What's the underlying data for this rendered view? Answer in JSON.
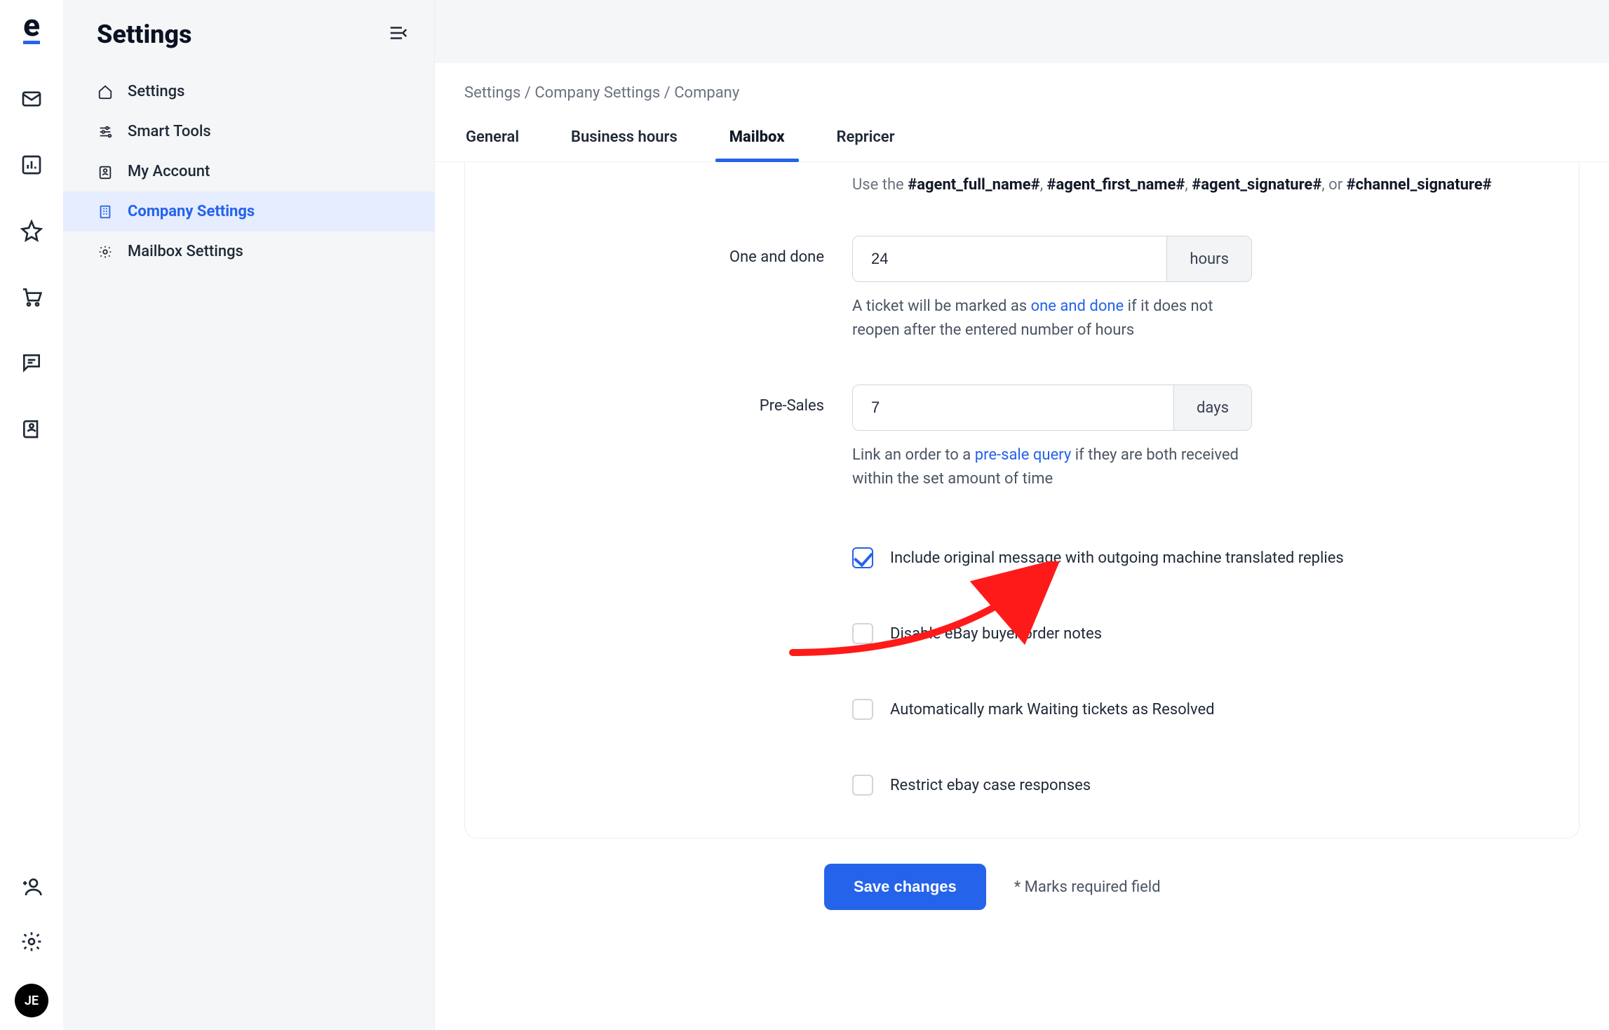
{
  "colors": {
    "accent": "#2563eb"
  },
  "rail": {
    "logo": "e",
    "avatar": "JE"
  },
  "sidebar": {
    "title": "Settings",
    "items": [
      {
        "label": "Settings"
      },
      {
        "label": "Smart Tools"
      },
      {
        "label": "My Account"
      },
      {
        "label": "Company Settings"
      },
      {
        "label": "Mailbox Settings"
      }
    ]
  },
  "breadcrumb": {
    "a": "Settings",
    "b": "Company Settings",
    "c": "Company"
  },
  "tabs": [
    {
      "label": "General"
    },
    {
      "label": "Business hours"
    },
    {
      "label": "Mailbox"
    },
    {
      "label": "Repricer"
    }
  ],
  "hint": {
    "prefix": "Use the ",
    "c1": "#agent_full_name#",
    "c2": "#agent_first_name#",
    "c3": "#agent_signature#",
    "c4": "#channel_signature#",
    "sep": ", ",
    "or": ", or "
  },
  "form": {
    "one_and_done": {
      "label": "One and done",
      "value": "24",
      "unit": "hours",
      "helper_pre": "A ticket will be marked as ",
      "helper_link": "one and done",
      "helper_post": " if it does not reopen after the entered number of hours"
    },
    "pre_sales": {
      "label": "Pre-Sales",
      "value": "7",
      "unit": "days",
      "helper_pre": "Link an order to a ",
      "helper_link": "pre-sale query",
      "helper_post": " if they are both received within the set amount of time"
    }
  },
  "checkboxes": {
    "include_original": {
      "label": "Include original message with outgoing machine translated replies",
      "checked": true
    },
    "disable_ebay_notes": {
      "label": "Disable eBay buyer order notes",
      "checked": false
    },
    "auto_resolve_waiting": {
      "label": "Automatically mark Waiting tickets as Resolved",
      "checked": false
    },
    "restrict_ebay_case": {
      "label": "Restrict ebay case responses",
      "checked": false
    }
  },
  "footer": {
    "save": "Save changes",
    "required_note": "* Marks required field"
  }
}
